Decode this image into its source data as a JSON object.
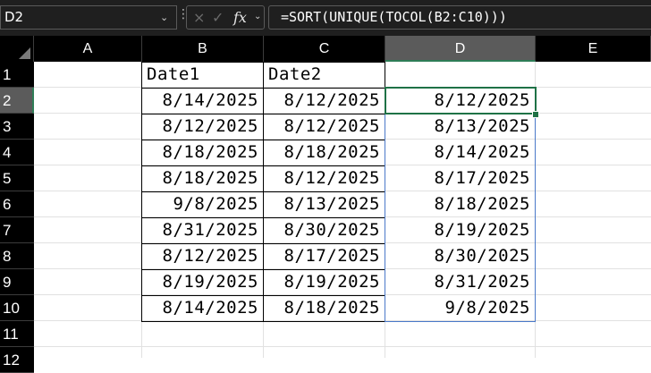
{
  "name_box": "D2",
  "formula": "=SORT(UNIQUE(TOCOL(B2:C10)))",
  "icons": {
    "cancel": "×",
    "enter": "✓",
    "fx": "fx",
    "dropdown": "⌄",
    "more": "⋮"
  },
  "columns": [
    "A",
    "B",
    "C",
    "D",
    "E"
  ],
  "rows": [
    "1",
    "2",
    "3",
    "4",
    "5",
    "6",
    "7",
    "8",
    "9",
    "10",
    "11",
    "12"
  ],
  "headers": {
    "b": "Date1",
    "c": "Date2"
  },
  "date1": [
    "8/14/2025",
    "8/12/2025",
    "8/18/2025",
    "8/18/2025",
    "9/8/2025",
    "8/31/2025",
    "8/12/2025",
    "8/19/2025",
    "8/14/2025"
  ],
  "date2": [
    "8/12/2025",
    "8/12/2025",
    "8/18/2025",
    "8/12/2025",
    "8/13/2025",
    "8/30/2025",
    "8/17/2025",
    "8/19/2025",
    "8/18/2025"
  ],
  "result": [
    "8/12/2025",
    "8/13/2025",
    "8/14/2025",
    "8/17/2025",
    "8/18/2025",
    "8/19/2025",
    "8/30/2025",
    "8/31/2025",
    "9/8/2025"
  ],
  "colors": {
    "selection": "#1f7246",
    "spill_border": "#4a79c9",
    "header_bg": "#000000"
  }
}
